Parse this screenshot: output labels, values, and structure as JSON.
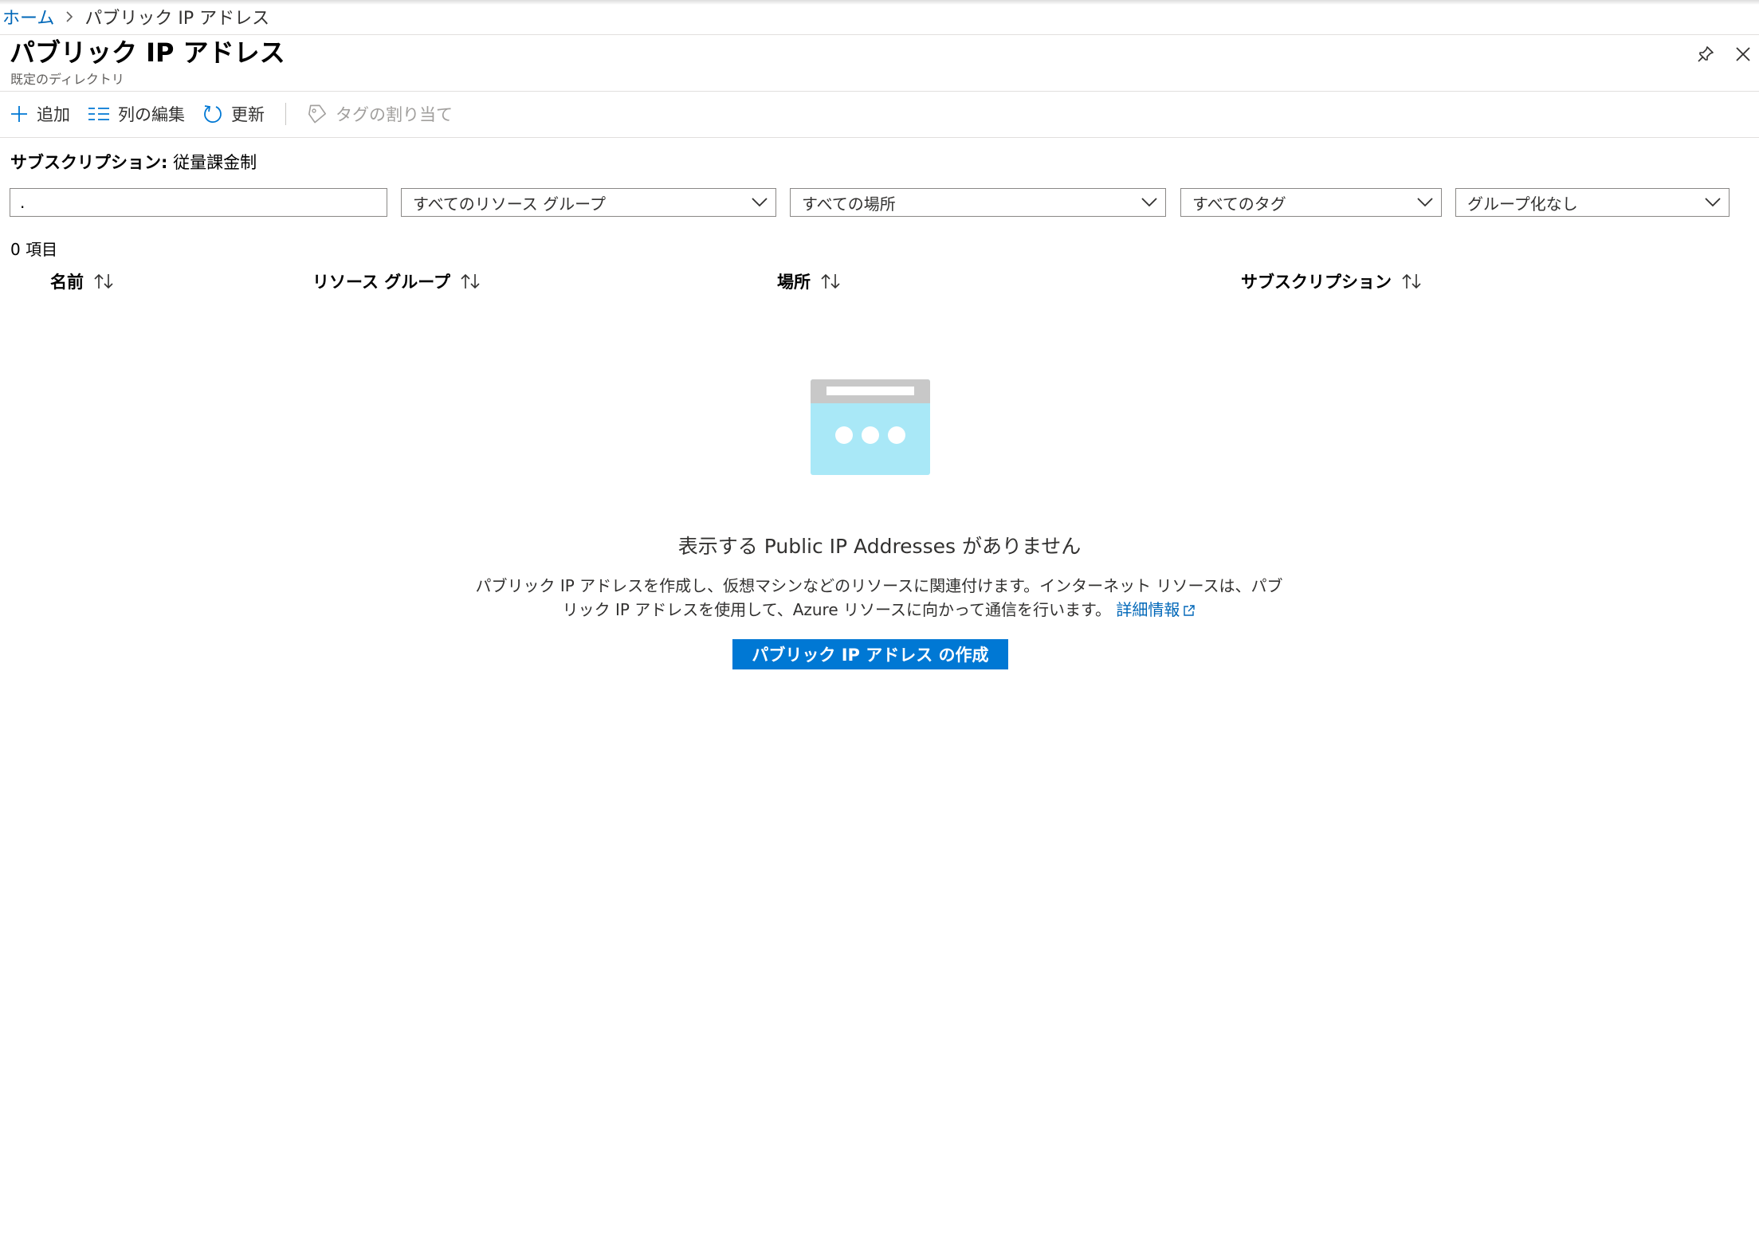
{
  "breadcrumb": {
    "home": "ホーム",
    "current": "パブリック IP アドレス"
  },
  "header": {
    "title": "パブリック IP アドレス",
    "subtitle": "既定のディレクトリ"
  },
  "toolbar": {
    "add": "追加",
    "edit_columns": "列の編集",
    "refresh": "更新",
    "assign_tags": "タグの割り当て"
  },
  "subscription": {
    "label": "サブスクリプション:",
    "value": "従量課金制"
  },
  "filters": {
    "search_value": ".",
    "resource_group": "すべてのリソース グループ",
    "location": "すべての場所",
    "tags": "すべてのタグ",
    "grouping": "グループ化なし"
  },
  "list": {
    "count": "0 項目",
    "columns": [
      "名前",
      "リソース グループ",
      "場所",
      "サブスクリプション"
    ]
  },
  "empty_state": {
    "title": "表示する Public IP Addresses がありません",
    "desc_line1": "パブリック IP アドレスを作成し、仮想マシンなどのリソースに関連付けます。インターネット リソースは、パブ",
    "desc_line2": "リック IP アドレスを使用して、Azure リソースに向かって通信を行います。",
    "learn_more": "詳細情報",
    "create_button": "パブリック IP アドレス の作成"
  },
  "colors": {
    "accent": "#0078d4",
    "link": "#0067b8"
  },
  "icons": [
    "chevron-right-icon",
    "pin-icon",
    "close-icon",
    "plus-icon",
    "columns-icon",
    "refresh-icon",
    "tag-icon",
    "chevron-down-icon",
    "sort-icon",
    "empty-list-icon",
    "external-link-icon"
  ]
}
